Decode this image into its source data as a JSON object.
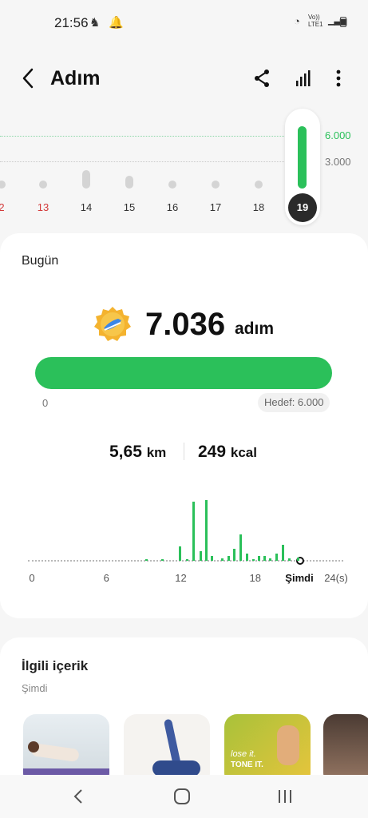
{
  "status": {
    "time": "21:56",
    "network": "Vo)) LTE1"
  },
  "header": {
    "title": "Adım"
  },
  "week": {
    "goal_label": "6.000",
    "mid_label": "3.000",
    "days": [
      {
        "label": "2",
        "red": true,
        "level": 0.06
      },
      {
        "label": "13",
        "red": true,
        "level": 0.06
      },
      {
        "label": "14",
        "red": false,
        "level": 0.3
      },
      {
        "label": "15",
        "red": false,
        "level": 0.2
      },
      {
        "label": "16",
        "red": false,
        "level": 0.06
      },
      {
        "label": "17",
        "red": false,
        "level": 0.06
      },
      {
        "label": "18",
        "red": false,
        "level": 0.06
      }
    ],
    "selected_day": "19",
    "selected_level": 1.0
  },
  "today": {
    "title": "Bugün",
    "steps": "7.036",
    "steps_unit": "adım",
    "progress": 1.0,
    "progress_start": "0",
    "goal": "Hedef: 6.000",
    "distance": "5,65",
    "distance_unit": "km",
    "calories": "249",
    "calories_unit": "kcal",
    "hour_labels": [
      "0",
      "6",
      "12",
      "18",
      "24(s)"
    ],
    "now_label": "Şimdi",
    "hourly": [
      {
        "h": 9.2,
        "v": 0.02
      },
      {
        "h": 10.5,
        "v": 0.02
      },
      {
        "h": 11.9,
        "v": 0.24
      },
      {
        "h": 12.5,
        "v": 0.02
      },
      {
        "h": 13.0,
        "v": 1.0
      },
      {
        "h": 13.6,
        "v": 0.16
      },
      {
        "h": 14.0,
        "v": 1.03
      },
      {
        "h": 14.5,
        "v": 0.08
      },
      {
        "h": 15.3,
        "v": 0.04
      },
      {
        "h": 15.8,
        "v": 0.08
      },
      {
        "h": 16.3,
        "v": 0.2
      },
      {
        "h": 16.8,
        "v": 0.44
      },
      {
        "h": 17.3,
        "v": 0.12
      },
      {
        "h": 17.8,
        "v": 0.02
      },
      {
        "h": 18.3,
        "v": 0.08
      },
      {
        "h": 18.7,
        "v": 0.08
      },
      {
        "h": 19.2,
        "v": 0.04
      },
      {
        "h": 19.7,
        "v": 0.12
      },
      {
        "h": 20.2,
        "v": 0.27
      },
      {
        "h": 20.7,
        "v": 0.04
      },
      {
        "h": 21.4,
        "v": 0.06
      }
    ]
  },
  "related": {
    "title": "İlgili içerik",
    "subtitle": "Şimdi",
    "thumb_texts": [
      "lose it.",
      "TONE IT."
    ]
  },
  "colors": {
    "accent": "#2bc05a",
    "selected_day_bg": "#2a2a2a",
    "weekend": "#d33b3b"
  }
}
